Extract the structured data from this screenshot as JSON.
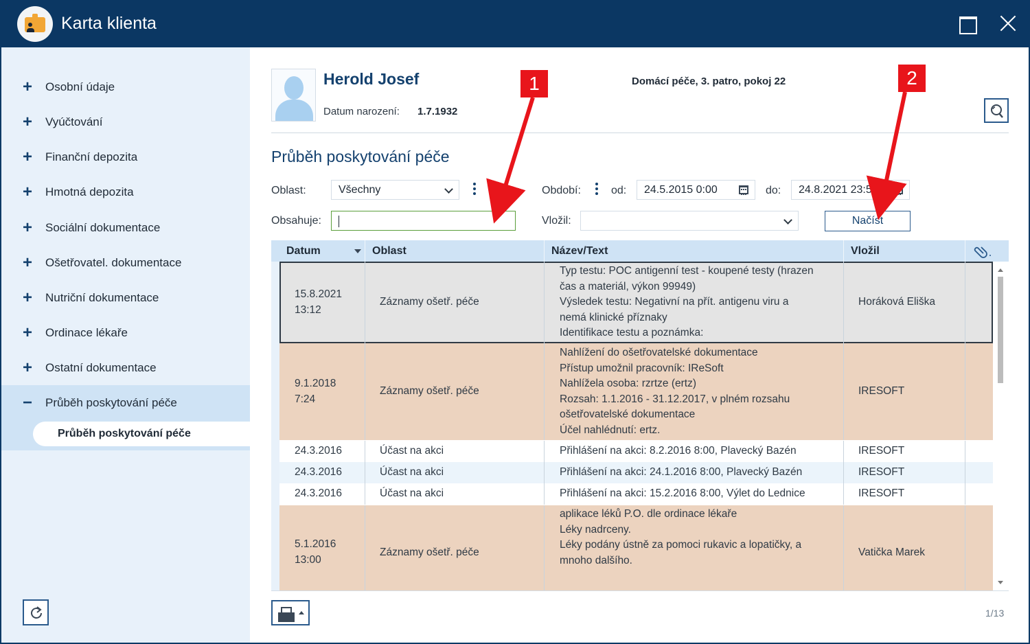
{
  "window": {
    "title": "Karta klienta"
  },
  "sidebar": {
    "items": [
      {
        "sign": "+",
        "label": "Osobní údaje"
      },
      {
        "sign": "+",
        "label": "Vyúčtování"
      },
      {
        "sign": "+",
        "label": "Finanční depozita"
      },
      {
        "sign": "+",
        "label": "Hmotná depozita"
      },
      {
        "sign": "+",
        "label": "Sociální dokumentace"
      },
      {
        "sign": "+",
        "label": "Ošetřovatel. dokumentace"
      },
      {
        "sign": "+",
        "label": "Nutriční dokumentace"
      },
      {
        "sign": "+",
        "label": "Ordinace lékaře"
      },
      {
        "sign": "+",
        "label": "Ostatní dokumentace"
      },
      {
        "sign": "−",
        "label": "Průběh poskytování péče"
      }
    ],
    "subitem": "Průběh poskytování péče"
  },
  "client": {
    "name": "Herold Josef",
    "birth_label": "Datum narození:",
    "birth_value": "1.7.1932",
    "location": "Domácí péče, 3. patro, pokoj 22"
  },
  "section_title": "Průběh poskytování péče",
  "filters": {
    "area_label": "Oblast:",
    "area_value": "Všechny",
    "contains_label": "Obsahuje:",
    "contains_value": "",
    "period_label": "Období:",
    "from_label": "od:",
    "from_value": "24.5.2015 0:00",
    "to_label": "do:",
    "to_value": "24.8.2021 23:59",
    "inserted_label": "Vložil:",
    "inserted_value": "",
    "load_label": "Načíst"
  },
  "table": {
    "headers": [
      "Datum",
      "Oblast",
      "Název/Text",
      "Vložil"
    ],
    "rows": [
      {
        "date": [
          "15.8.2021",
          "13:12"
        ],
        "area": "Záznamy ošetř. péče",
        "text": [
          "Typ testu: POC antigenní test - koupené testy (hrazen",
          "čas a materiál, výkon 99949)",
          "Výsledek testu: Negativní na přít. antigenu viru a",
          "nemá klinické příznaky",
          "Identifikace testu a poznámka:"
        ],
        "by": "Horáková Eliška"
      },
      {
        "date": [
          "9.1.2018",
          "7:24"
        ],
        "area": "Záznamy ošetř. péče",
        "text": [
          "Nahlížení do ošetřovatelské dokumentace",
          "Přístup umožnil pracovník: IReSoft",
          "Nahlížela osoba: rzrtze (ertz)",
          "Rozsah: 1.1.2016 - 31.12.2017, v plném rozsahu",
          "ošetřovatelské dokumentace",
          "Účel nahlédnutí: ertz."
        ],
        "by": "IRESOFT"
      },
      {
        "date": [
          "24.3.2016"
        ],
        "area": "Účast na akci",
        "text": [
          "Přihlášení na akci: 8.2.2016 8:00, Plavecký Bazén"
        ],
        "by": "IRESOFT"
      },
      {
        "date": [
          "24.3.2016"
        ],
        "area": "Účast na akci",
        "text": [
          "Přihlášení na akci: 24.1.2016 8:00, Plavecký Bazén"
        ],
        "by": "IRESOFT"
      },
      {
        "date": [
          "24.3.2016"
        ],
        "area": "Účast na akci",
        "text": [
          "Přihlášení na akci: 15.2.2016 8:00, Výlet do Lednice"
        ],
        "by": "IRESOFT"
      },
      {
        "date": [
          "5.1.2016",
          "13:00"
        ],
        "area": "Záznamy ošetř. péče",
        "text": [
          "aplikace léků P.O. dle ordinace lékaře",
          "Léky nadrceny.",
          "Léky podány ústně za pomoci rukavic a lopatičky, a",
          "mnoho dalšího."
        ],
        "by": "Vatička Marek"
      }
    ]
  },
  "pager": "1/13",
  "annotations": {
    "badge1": "1",
    "badge2": "2"
  },
  "colors": {
    "titlebar": "#0b3763",
    "accent": "#14416e",
    "sidebar_bg": "#e8f1fa",
    "sidebar_active": "#cfe3f5",
    "row_peach": "#ecd3bf",
    "row_gray": "#e4e4e4",
    "annotation_red": "#e8151b"
  },
  "icons": {
    "app": "client-card-icon",
    "maximize": "maximize-icon",
    "close": "close-icon",
    "search": "search-icon",
    "refresh": "refresh-icon",
    "print": "printer-icon",
    "attachment": "paperclip-icon",
    "calendar": "calendar-icon"
  }
}
